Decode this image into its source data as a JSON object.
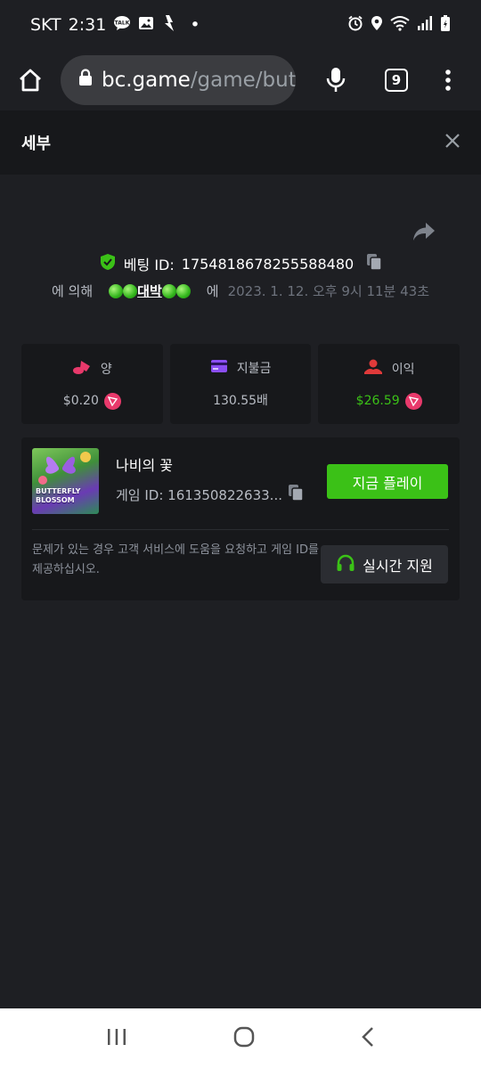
{
  "status_bar": {
    "carrier": "SKT",
    "time": "2:31",
    "dot": "•"
  },
  "browser": {
    "url_host": "bc.game",
    "url_path": "/game/butt",
    "tab_count": "9"
  },
  "modal": {
    "title": "세부"
  },
  "bet": {
    "label": "베팅 ID:",
    "id": "1754818678255588480",
    "by_prefix": "에 의해",
    "player_name": "대박",
    "at_word": "에",
    "date": "2023. 1. 12. 오후 9시 11분 43초"
  },
  "stats": [
    {
      "label": "양",
      "value": "$0.20",
      "icon": "coins-icon",
      "has_token": true,
      "color": "#e8396b"
    },
    {
      "label": "지불금",
      "value": "130.55배",
      "icon": "card-icon",
      "has_token": false,
      "color": "#8b4ef3"
    },
    {
      "label": "이익",
      "value": "$26.59",
      "icon": "profit-icon",
      "has_token": true,
      "color": "#e03a3a"
    }
  ],
  "game": {
    "name": "나비의 꽃",
    "id_text": "게임 ID: 161350822633...",
    "thumb_text_1": "BUTTERFLY",
    "thumb_text_2": "BLOSSOM",
    "play_label": "지금 플레이",
    "help_text": "문제가 있는 경우 고객 서비스에 도움을 요청하고 게임 ID를 제공하십시오.",
    "support_label": "실시간 지원"
  },
  "colors": {
    "accent_green": "#3bc117",
    "bg": "#1e1f23",
    "card": "#17181b"
  }
}
